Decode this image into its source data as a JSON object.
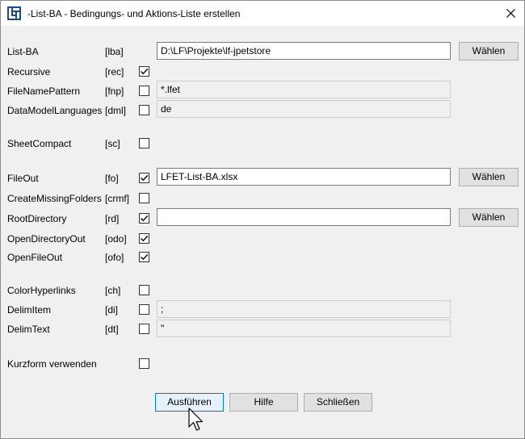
{
  "window": {
    "title": "-List-BA - Bedingungs- und Aktions-Liste erstellen",
    "app_icon": "lfet-app-icon",
    "close_icon": "close-icon"
  },
  "rows": {
    "lba": {
      "label": "List-BA",
      "arg": "[lba]",
      "value": "D:\\LF\\Projekte\\lf-jpetstore",
      "button": "Wählen"
    },
    "rec": {
      "label": "Recursive",
      "arg": "[rec]",
      "checked": true
    },
    "fnp": {
      "label": "FileNamePattern",
      "arg": "[fnp]",
      "checked": false,
      "value": "*.lfet"
    },
    "dml": {
      "label": "DataModelLanguages",
      "arg": "[dml]",
      "checked": false,
      "value": "de"
    },
    "sc": {
      "label": "SheetCompact",
      "arg": "[sc]",
      "checked": false
    },
    "fo": {
      "label": "FileOut",
      "arg": "[fo]",
      "checked": true,
      "value": "LFET-List-BA.xlsx",
      "button": "Wählen"
    },
    "crmf": {
      "label": "CreateMissingFolders",
      "arg": "[crmf]",
      "checked": false
    },
    "rd": {
      "label": "RootDirectory",
      "arg": "[rd]",
      "checked": true,
      "value": "",
      "button": "Wählen"
    },
    "odo": {
      "label": "OpenDirectoryOut",
      "arg": "[odo]",
      "checked": true
    },
    "ofo": {
      "label": "OpenFileOut",
      "arg": "[ofo]",
      "checked": true
    },
    "ch": {
      "label": "ColorHyperlinks",
      "arg": "[ch]",
      "checked": false
    },
    "di": {
      "label": "DelimItem",
      "arg": "[di]",
      "checked": false,
      "value": ";"
    },
    "dt": {
      "label": "DelimText",
      "arg": "[dt]",
      "checked": false,
      "value": "\""
    },
    "kurz": {
      "label": "Kurzform verwenden",
      "checked": false
    }
  },
  "footer": {
    "run": "Ausführen",
    "help": "Hilfe",
    "close": "Schließen"
  },
  "colors": {
    "accent": "#0078d7",
    "window_bg": "#f0f0f0",
    "icon_blue": "#1e4a8c"
  }
}
